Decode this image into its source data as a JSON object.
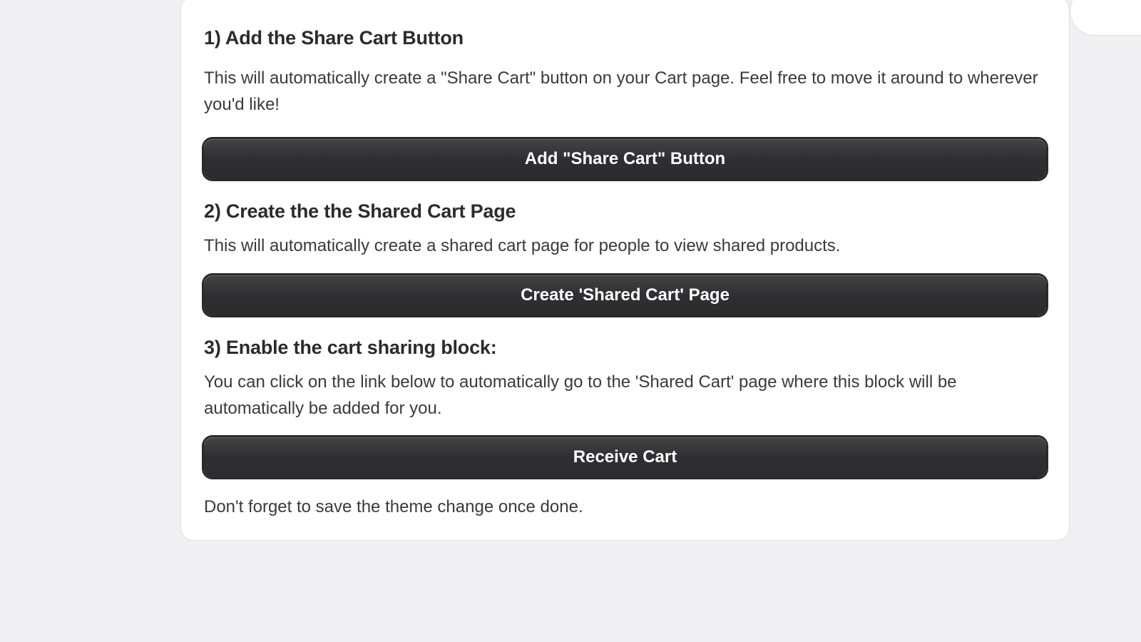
{
  "steps": [
    {
      "heading": "1) Add the Share Cart Button",
      "description": "This will automatically create a \"Share Cart\" button on your Cart page. Feel free to move it around to wherever you'd like!",
      "button_label": "Add \"Share Cart\" Button"
    },
    {
      "heading": "2) Create the the Shared Cart Page",
      "description": "This will automatically create a shared cart page for people to view shared products.",
      "button_label": "Create 'Shared Cart' Page"
    },
    {
      "heading": "3) Enable the cart sharing block:",
      "description": "You can click on the link below to automatically go to the 'Shared Cart' page where this block will be automatically be added for you.",
      "button_label": "Receive Cart"
    }
  ],
  "footer_note": "Don't forget to save the theme change once done."
}
